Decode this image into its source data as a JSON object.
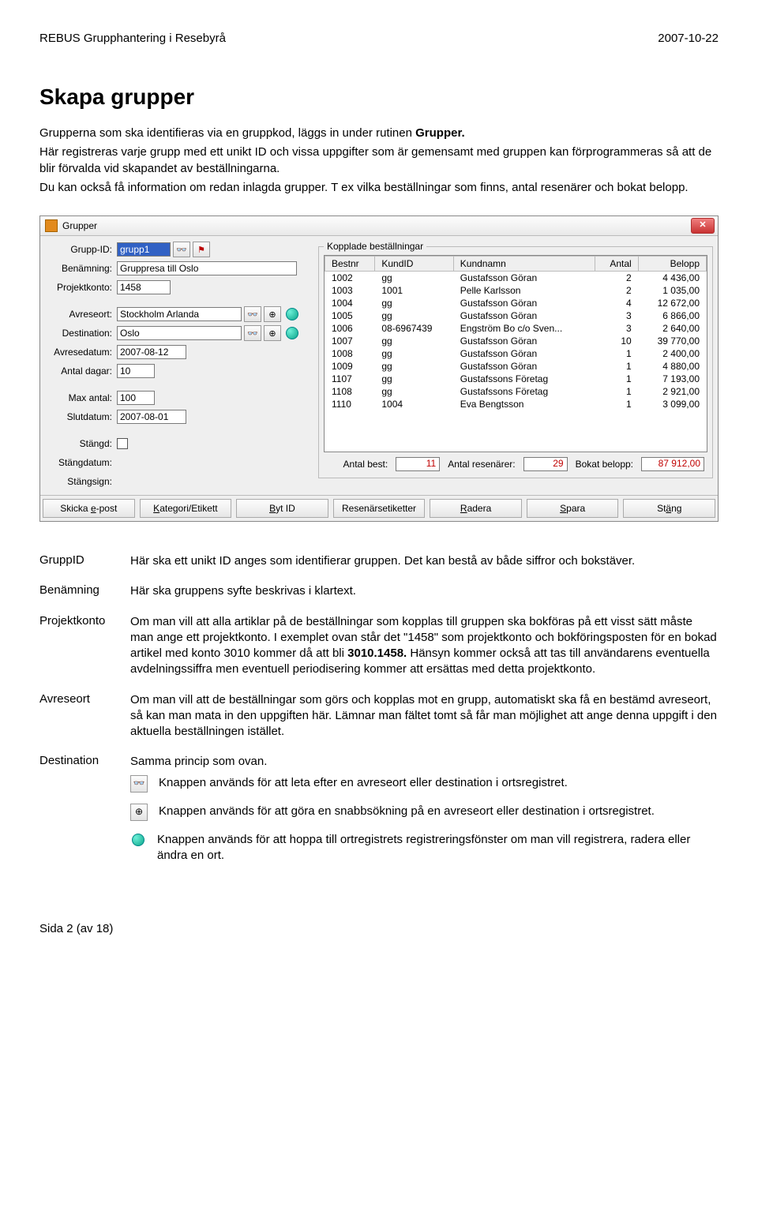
{
  "header": {
    "left": "REBUS Grupphantering i Resebyrå",
    "right": "2007-10-22"
  },
  "title": "Skapa grupper",
  "intro": {
    "p1a": "Grupperna som ska identifieras via en gruppkod, läggs in under rutinen ",
    "p1b": "Grupper.",
    "p2": "Här registreras varje grupp med ett unikt ID och vissa uppgifter som är gemensamt med gruppen kan förprogrammeras så att de blir förvalda vid skapandet av beställningarna.",
    "p3": "Du kan också få information om redan inlagda grupper. T ex vilka beställningar som finns, antal resenärer och bokat belopp."
  },
  "dialog": {
    "title": "Grupper",
    "labels": {
      "gruppid": "Grupp-ID:",
      "benamning": "Benämning:",
      "projektkonto": "Projektkonto:",
      "avreseort": "Avreseort:",
      "destination": "Destination:",
      "avresedatum": "Avresedatum:",
      "antaldagar": "Antal dagar:",
      "maxantal": "Max antal:",
      "slutdatum": "Slutdatum:",
      "stangd": "Stängd:",
      "stangdatum": "Stängdatum:",
      "stangsign": "Stängsign:"
    },
    "values": {
      "gruppid": "grupp1",
      "benamning": "Gruppresa till Oslo",
      "projektkonto": "1458",
      "avreseort": "Stockholm Arlanda",
      "destination": "Oslo",
      "avresedatum": "2007-08-12",
      "antaldagar": "10",
      "maxantal": "100",
      "slutdatum": "2007-08-01",
      "stangdatum": "",
      "stangsign": ""
    },
    "kopplade_legend": "Kopplade beställningar",
    "table": {
      "headers": [
        "Bestnr",
        "KundID",
        "Kundnamn",
        "Antal",
        "Belopp"
      ],
      "rows": [
        [
          "1002",
          "gg",
          "Gustafsson Göran",
          "2",
          "4 436,00"
        ],
        [
          "1003",
          "1001",
          "Pelle Karlsson",
          "2",
          "1 035,00"
        ],
        [
          "1004",
          "gg",
          "Gustafsson Göran",
          "4",
          "12 672,00"
        ],
        [
          "1005",
          "gg",
          "Gustafsson Göran",
          "3",
          "6 866,00"
        ],
        [
          "1006",
          "08-6967439",
          "Engström Bo c/o Sven...",
          "3",
          "2 640,00"
        ],
        [
          "1007",
          "gg",
          "Gustafsson Göran",
          "10",
          "39 770,00"
        ],
        [
          "1008",
          "gg",
          "Gustafsson Göran",
          "1",
          "2 400,00"
        ],
        [
          "1009",
          "gg",
          "Gustafsson Göran",
          "1",
          "4 880,00"
        ],
        [
          "1107",
          "gg",
          "Gustafssons Företag",
          "1",
          "7 193,00"
        ],
        [
          "1108",
          "gg",
          "Gustafssons Företag",
          "1",
          "2 921,00"
        ],
        [
          "1110",
          "1004",
          "Eva Bengtsson",
          "1",
          "3 099,00"
        ]
      ]
    },
    "summary": {
      "antal_best_label": "Antal best:",
      "antal_best": "11",
      "antal_res_label": "Antal resenärer:",
      "antal_res": "29",
      "bokat_label": "Bokat belopp:",
      "bokat": "87 912,00"
    },
    "buttons": {
      "epost_pre": "Skicka ",
      "epost_ul": "e",
      "epost_post": "-post",
      "kat_ul": "K",
      "kat_post": "ategori/Etikett",
      "byt_ul": "B",
      "byt_post": "yt ID",
      "resen": "Resenärsetiketter",
      "radera_ul": "R",
      "radera_post": "adera",
      "spara_ul": "S",
      "spara_post": "para",
      "stang_pre": "St",
      "stang_ul": "ä",
      "stang_post": "ng"
    }
  },
  "defs": {
    "gruppid": {
      "term": "GruppID",
      "body": "Här ska ett unikt ID anges som identifierar gruppen. Det kan bestå av både siffror och bokstäver."
    },
    "benamning": {
      "term": "Benämning",
      "body": "Här ska gruppens syfte beskrivas i klartext."
    },
    "projektkonto": {
      "term": "Projektkonto",
      "b1": "Om man vill att alla artiklar på de beställningar som kopplas till gruppen ska bokföras på ett visst sätt måste man ange ett projektkonto. I exemplet ovan står det \"1458\" som projektkonto och bokföringsposten för en bokad artikel med konto 3010 kommer då att bli ",
      "b2": "3010.1458.",
      "b3": " Hänsyn kommer också att tas till användarens eventuella avdelningssiffra men eventuell periodisering kommer att ersättas med detta projektkonto."
    },
    "avreseort": {
      "term": "Avreseort",
      "body": "Om man vill att de beställningar som görs och kopplas mot en grupp, automatiskt ska få en bestämd avreseort, så kan man mata in den uppgiften här. Lämnar man fältet tomt så får man möjlighet att ange denna uppgift i den aktuella beställningen istället."
    },
    "destination": {
      "term": "Destination",
      "body": "Samma princip som ovan.",
      "icon1": "Knappen används för att leta efter en avreseort eller destination i ortsregistret.",
      "icon2": "Knappen används för att göra en snabbsökning på en avreseort eller destination i ortsregistret.",
      "icon3": "Knappen används för att hoppa till ortregistrets registreringsfönster om man vill registrera, radera eller ändra en ort."
    }
  },
  "footer": "Sida 2 (av 18)",
  "icons": {
    "binoc": "🔍",
    "mag": "⊕"
  }
}
